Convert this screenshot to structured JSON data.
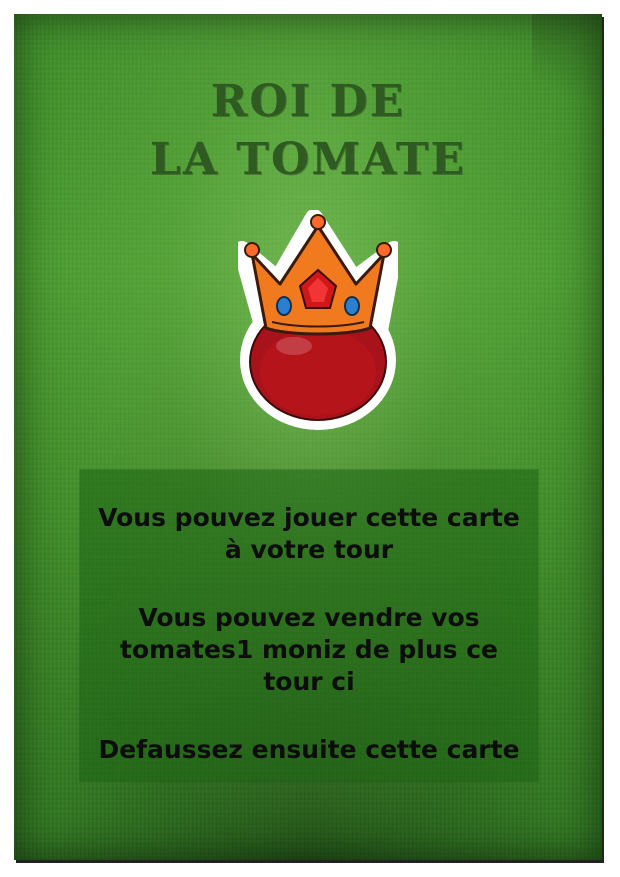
{
  "card": {
    "title_line1": "ROI DE",
    "title_line2": "LA TOMATE",
    "emblem_icon": "crowned-tomato-icon",
    "rules": [
      "Vous pouvez jouer cette carte",
      "à votre tour",
      "Vous pouvez vendre vos",
      "tomates1 moniz de plus ce",
      "tour ci",
      "Defaussez ensuite cette carte"
    ]
  },
  "colors": {
    "card_green": "#4a9c30",
    "title_color": "#2f5a22",
    "crown_orange": "#f07a1f",
    "tomato_red": "#b3141a"
  }
}
